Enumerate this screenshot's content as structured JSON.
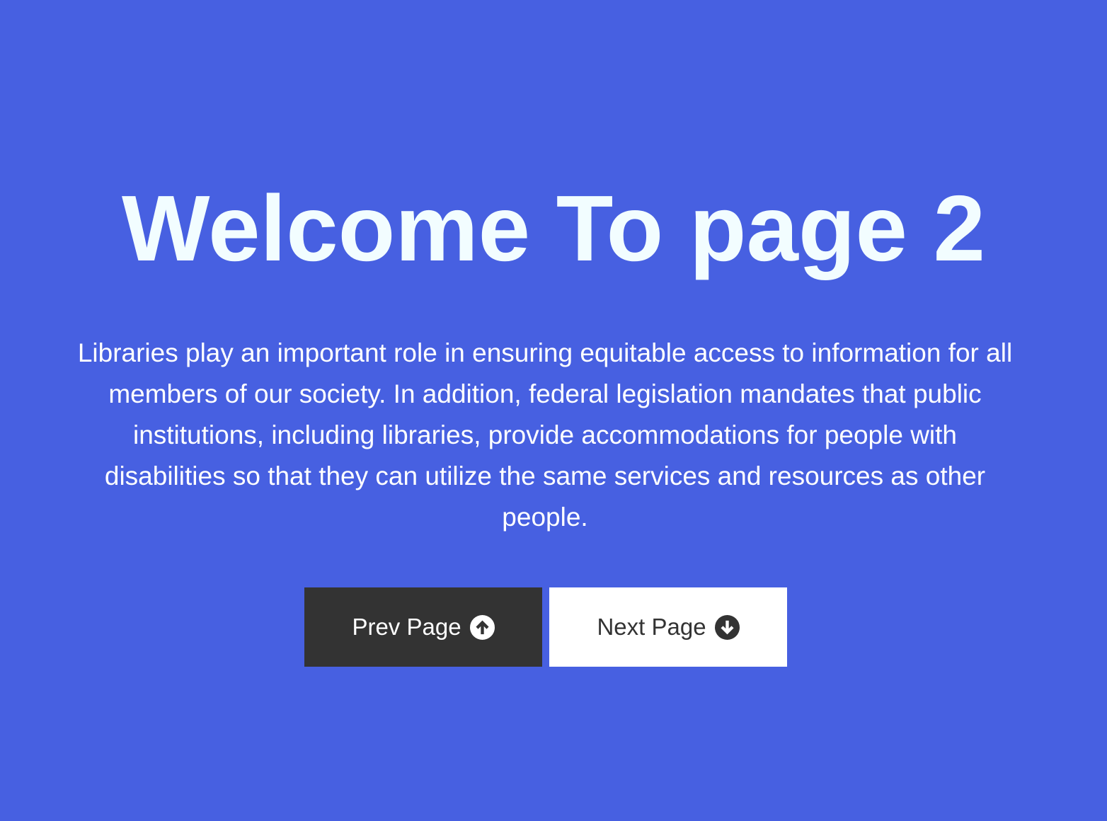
{
  "colors": {
    "background": "#4760e1",
    "headline": "#f2fdff",
    "intro_text": "#ffffff",
    "prev_button_bg": "#333333",
    "prev_button_text": "#ffffff",
    "next_button_bg": "#ffffff",
    "next_button_text": "#333333"
  },
  "main": {
    "title": "Welcome To page 2",
    "intro_text": "Libraries play an important role in ensuring equitable access to information for all members of our society. In addition, federal legislation mandates that public institutions, including libraries, provide accommodations for people with disabilities so that they can utilize the same services and resources as other people."
  },
  "navigation": {
    "prev_label": "Prev Page",
    "prev_icon": "arrow-circle-up-icon",
    "next_label": "Next Page",
    "next_icon": "arrow-circle-down-icon"
  }
}
